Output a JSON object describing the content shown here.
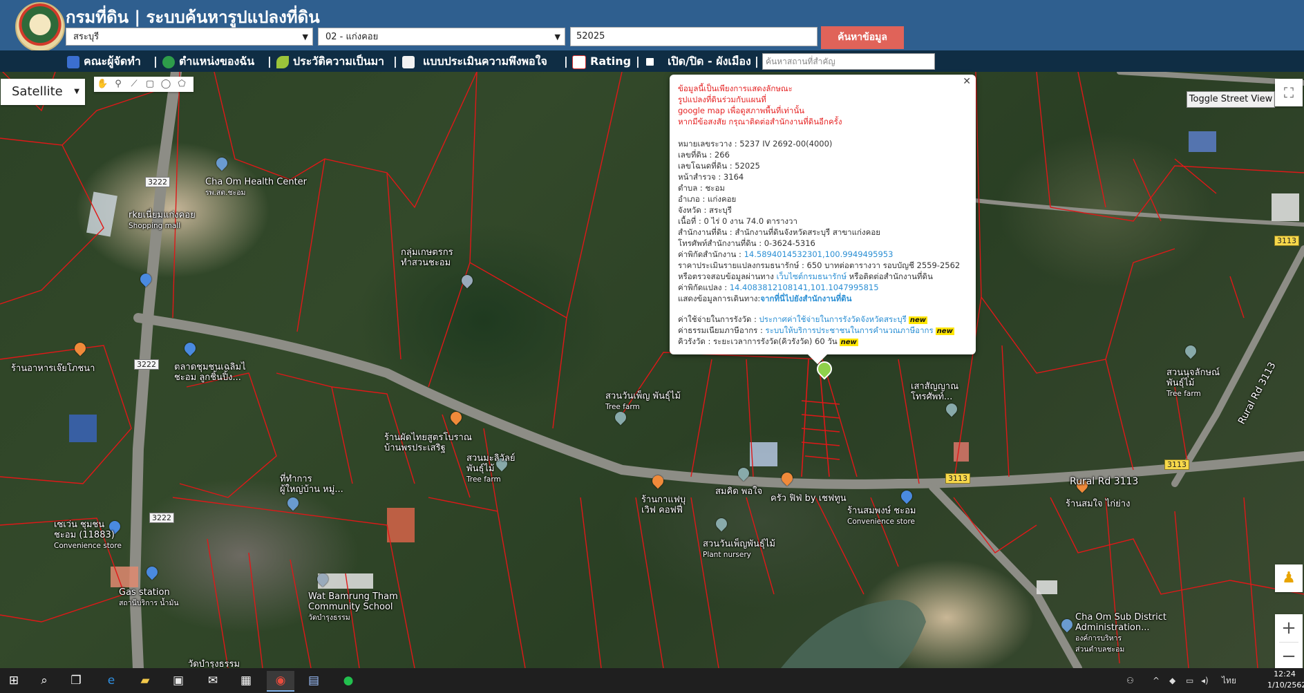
{
  "header": {
    "title": "กรมที่ดิน | ระบบค้นหารูปแปลงที่ดิน",
    "province": "สระบุรี",
    "district": "02 - แก่งคอย",
    "deed_number": "52025",
    "search_label": "ค้นหาข้อมูล"
  },
  "nav": {
    "items": [
      "คณะผู้จัดทำ",
      "ตำแหน่งของฉัน",
      "ประวัติความเป็นมา",
      "แบบประเมินความพึงพอใจ",
      "Rating",
      "เปิด/ปิด - ผังเมือง"
    ],
    "separator": "|",
    "place_search_placeholder": "ค้นหาสถานที่สำคัญ"
  },
  "map_controls": {
    "map_type": "Satellite",
    "toggle_street_view": "Toggle Street View"
  },
  "info": {
    "disclaimer": [
      "ข้อมูลนี้เป็นเพียงการแสดงลักษณะ",
      "รูปแปลงที่ดินร่วมกับแผนที่",
      "google map เพื่อดูสภาพพื้นที่เท่านั้น",
      "หากมีข้อสงสัย กรุณาติดต่อสำนักงานที่ดินอีกครั้ง"
    ],
    "survey_sheet": "หมายเลขระวาง : 5237 IV 2692-00(4000)",
    "land_no": "เลขที่ดิน : 266",
    "deed_no": "เลขโฉนดที่ดิน : 52025",
    "survey_page": "หน้าสำรวจ : 3164",
    "subdistrict": "ตำบล : ชะอม",
    "district": "อำเภอ : แก่งคอย",
    "province": "จังหวัด : สระบุรี",
    "area": "เนื้อที่ : 0 ไร่ 0 งาน 74.0 ตารางวา",
    "office": "สำนักงานที่ดิน : สำนักงานที่ดินจังหวัดสระบุรี สาขาแก่งคอย",
    "office_phone": "โทรศัพท์สำนักงานที่ดิน : 0-3624-5316",
    "office_coord_label": "ค่าพิกัดสำนักงาน : ",
    "office_coord": "14.5894014532301,100.9949495953",
    "price": "ราคาประเมินรายแปลงกรมธนารักษ์ : 650 บาทต่อตารางวา รอบบัญชี 2559-2562",
    "treasury_prefix": "หรือตรวจสอบข้อมูลผ่านทาง ",
    "treasury_link": "เว็บไซต์กรมธนารักษ์",
    "treasury_suffix": " หรือติดต่อสำนักงานที่ดิน",
    "parcel_coord_label": "ค่าพิกัดแปลง : ",
    "parcel_coord": "14.4083812108141,101.1047995815",
    "route_label": "แสดงข้อมูลการเดินทาง:",
    "route_link": "จากที่นี่ไปยังสำนักงานที่ดิน",
    "fee_label": "ค่าใช้จ่ายในการรังวัด : ",
    "fee_link": "ประกาศค่าใช้จ่ายในการรังวัดจังหวัดสระบุรี",
    "tax_label": "ค่าธรรมเนียมภาษีอากร : ",
    "tax_link": "ระบบให้บริการประชาชนในการคำนวณภาษีอากร",
    "queue": "คิวรังวัด : ระยะเวลาการรังวัด(คิวรังวัด) 60 วัน",
    "new_badge": "new"
  },
  "map_labels": {
    "health_center": "Cha Om Health Center",
    "health_center_sub": "รพ.สต.ชะอม",
    "mall": "rkยเนี่ยมแก่งคอย",
    "mall_sub": "Shopping mall",
    "group_farm_1": "กลุ่มเกษตรกร",
    "group_farm_2": "ทำสวนชะอม",
    "restaurant_1": "ร้านอาหารเจ๊ยโภชนา",
    "market_1": "ตลาดชุมชนเฉลิมไ",
    "market_2": "ชะอม ลูกชิ้นปิ้ง...",
    "tree_farm_1": "สวนวันเพ็ญ พันธุ์ไม้",
    "tree_farm_1_sub": "Tree farm",
    "shop_1": "เสาสัญญาณ",
    "shop_1b": "โทรศัพท์...",
    "tree_farm_right": "สวนนุจลักษณ์",
    "tree_farm_right_b": "พันธุ์ไม้",
    "tree_farm_right_sub": "Tree farm",
    "pad_thai_1": "ร้านผัดไทยสูตรโบราณ",
    "pad_thai_2": "บ้านพรประเสริฐ",
    "mali_1": "สวนมะลิวัลย์",
    "mali_2": "พันธุ์ไม้",
    "mali_sub": "Tree farm",
    "village_1": "ที่ทำการ",
    "village_2": "ผู้ใหญ่บ้าน หมู่...",
    "seven_1": "เซเว่น ชุมชน",
    "seven_2": "ชะอม (11883)",
    "seven_sub": "Convenience store",
    "gas": "Gas station",
    "gas_sub": "สถานีบริการ น้ำมัน",
    "wat": "Wat Bamrung Tham",
    "wat_2": "Community School",
    "wat_sub": "วัดบำรุงธรรม",
    "wat_bottom": "วัดบำรุงธรรม",
    "cafe_1": "ร้านกาแฟบุ",
    "cafe_2": "เวิฟ คอฟฟี่",
    "somkid": "สมคิด พอใจ",
    "cafe_3": "ครัว ฟิฟ่ by เชฟทูน",
    "sompong_1": "ร้านสมพงษ์ ชะอม",
    "sompong_sub": "Convenience store",
    "nursery": "สวนวันเพ็ญพันธุ์ไม้",
    "nursery_sub": "Plant nursery",
    "somjai": "ร้านสมใจ ไก่ย่าง",
    "sao_1": "Cha Om Sub District",
    "sao_2": "Administration...",
    "sao_sub_1": "องค์การบริหาร",
    "sao_sub_2": "ส่วนตำบลชะอม",
    "rural_rd": "Rural Rd 3113",
    "rural_rd_v": "Rural Rd 3113",
    "route_3222": "3222",
    "route_3113": "3113"
  },
  "taskbar": {
    "lang": "ไทย",
    "time": "12:24",
    "date": "1/10/2562"
  },
  "colors": {
    "header_bg": "#2f5f8f",
    "navbar_bg": "#0f2d44",
    "search_button": "#e06359",
    "parcel_lines": "#e01818"
  }
}
